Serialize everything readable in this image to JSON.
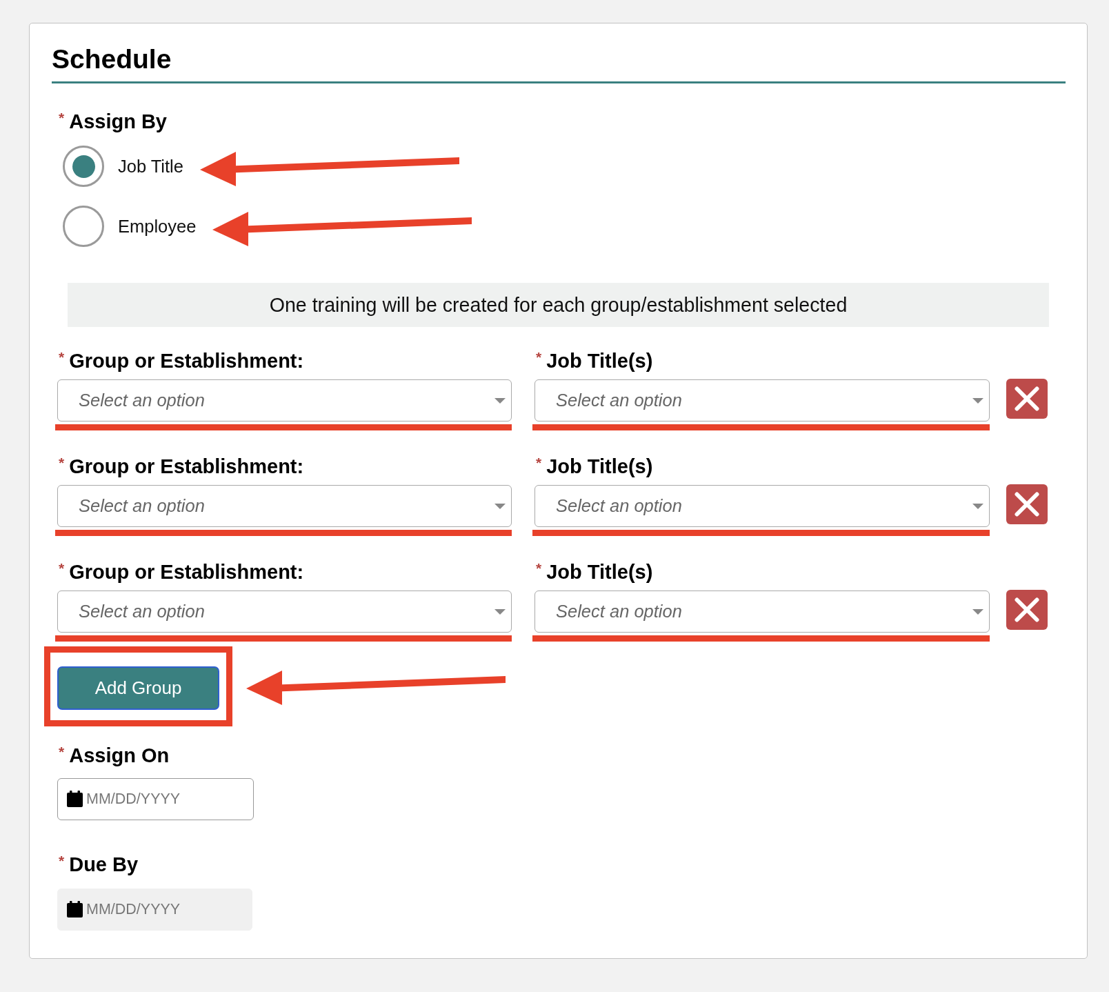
{
  "section": {
    "title": "Schedule"
  },
  "assign_by": {
    "required_mark": "*",
    "label": "Assign By",
    "options": [
      {
        "label": "Job Title",
        "selected": true,
        "callout": true
      },
      {
        "label": "Employee",
        "selected": false,
        "callout": true
      }
    ]
  },
  "notice": {
    "text": "One training will be created for each group/establishment selected"
  },
  "groups": [
    {
      "group_field": {
        "required_mark": "*",
        "label": "Group or Establishment:",
        "placeholder": "Select an option",
        "underlined": true
      },
      "job_field": {
        "required_mark": "*",
        "label": "Job Title(s)",
        "placeholder": "Select an option",
        "underlined": true
      }
    },
    {
      "group_field": {
        "required_mark": "*",
        "label": "Group or Establishment:",
        "placeholder": "Select an option",
        "underlined": true
      },
      "job_field": {
        "required_mark": "*",
        "label": "Job Title(s)",
        "placeholder": "Select an option",
        "underlined": true
      }
    },
    {
      "group_field": {
        "required_mark": "*",
        "label": "Group or Establishment:",
        "placeholder": "Select an option",
        "underlined": true
      },
      "job_field": {
        "required_mark": "*",
        "label": "Job Title(s)",
        "placeholder": "Select an option",
        "underlined": true
      }
    }
  ],
  "add_group_button": {
    "label": "Add Group",
    "focused": true,
    "framed": true,
    "callout": true
  },
  "assign_on": {
    "required_mark": "*",
    "label": "Assign On",
    "placeholder": "MM/DD/YYYY",
    "disabled": false
  },
  "due_by": {
    "required_mark": "*",
    "label": "Due By",
    "placeholder": "MM/DD/YYYY",
    "disabled": true
  }
}
